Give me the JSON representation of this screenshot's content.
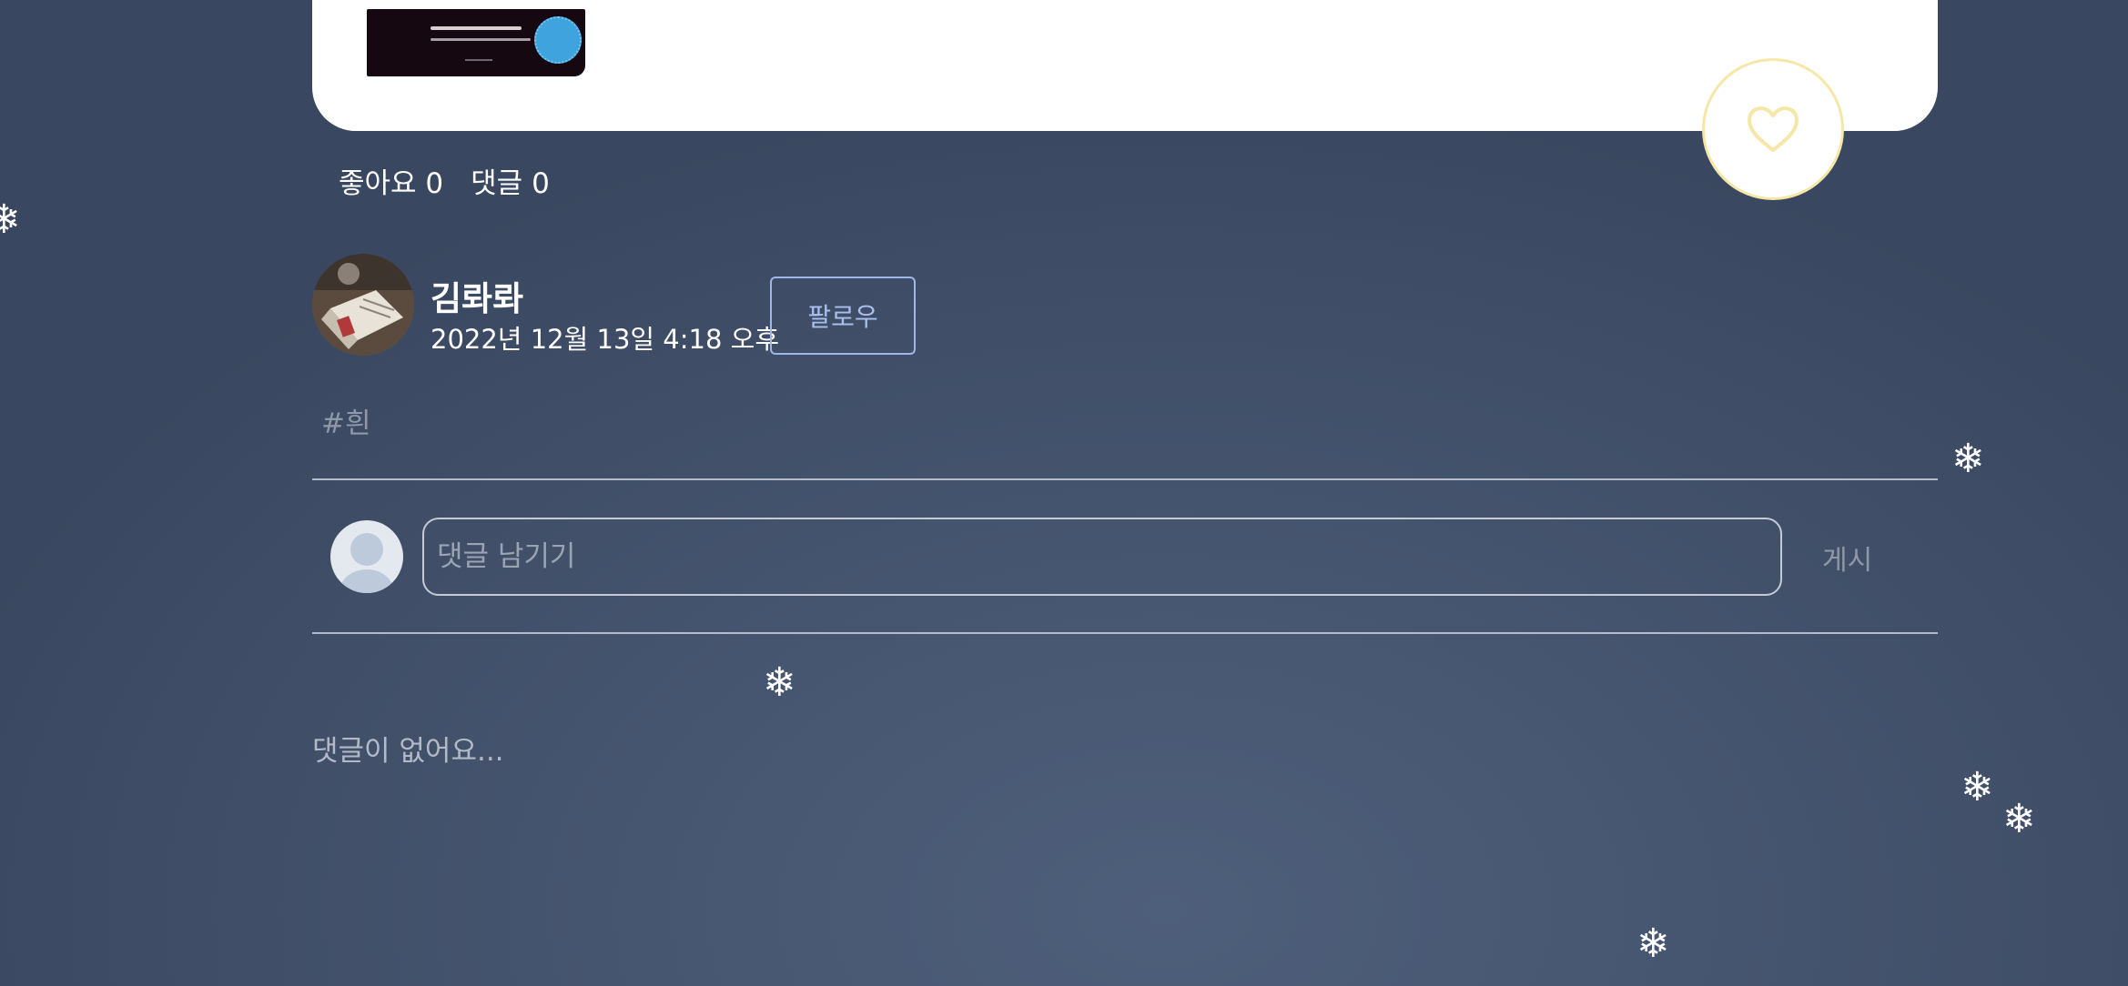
{
  "post": {
    "like_label": "좋아요",
    "like_count": "0",
    "comment_label": "댓글",
    "comment_count": "0",
    "like_icon": "heart-outline-icon",
    "accent_color": "#f7e7a6"
  },
  "author": {
    "name": "김롸롸",
    "date": "2022년 12월 13일 4:18 오후",
    "follow_label": "팔로우"
  },
  "tags": [
    "#흰"
  ],
  "comment_form": {
    "placeholder": "댓글 남기기",
    "submit_label": "게시"
  },
  "comments": {
    "empty_message": "댓글이 없어요..."
  },
  "decorations": {
    "snowflake_glyph": "❄"
  }
}
